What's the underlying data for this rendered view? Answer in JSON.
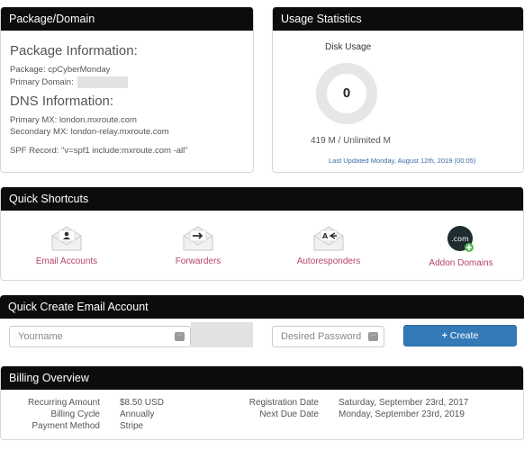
{
  "package_panel": {
    "title": "Package/Domain",
    "package_info_heading": "Package Information:",
    "package_line": "Package: cpCyberMonday",
    "primary_domain_label": "Primary Domain:",
    "dns_heading": "DNS Information:",
    "primary_mx": "Primary MX: london.mxroute.com",
    "secondary_mx": "Secondary MX: london-relay.mxroute.com",
    "spf": "SPF Record: \"v=spf1 include:mxroute.com -all\""
  },
  "usage_panel": {
    "title": "Usage Statistics",
    "disk_label": "Disk Usage",
    "gauge_value": "0",
    "usage_text": "419 M / Unlimited M",
    "updated": "Last Updated Monday, August 12th, 2019 (00:05)"
  },
  "shortcuts_panel": {
    "title": "Quick Shortcuts",
    "items": [
      {
        "label": "Email Accounts",
        "icon": "envelope-user-icon"
      },
      {
        "label": "Forwarders",
        "icon": "envelope-forward-icon"
      },
      {
        "label": "Autoresponders",
        "icon": "envelope-autoreply-icon"
      },
      {
        "label": "Addon Domains",
        "icon": "dotcom-add-icon",
        "icon_text": ".com"
      }
    ]
  },
  "create_panel": {
    "title": "Quick Create Email Account",
    "username_placeholder": "Yourname",
    "password_placeholder": "Desired Password",
    "create_button": "Create"
  },
  "billing_panel": {
    "title": "Billing Overview",
    "left_labels": [
      "Recurring Amount",
      "Billing Cycle",
      "Payment Method"
    ],
    "left_values": [
      "$8.50 USD",
      "Annually",
      "Stripe"
    ],
    "right_labels": [
      "Registration Date",
      "Next Due Date"
    ],
    "right_values": [
      "Saturday, September 23rd, 2017",
      "Monday, September 23rd, 2019"
    ]
  },
  "colors": {
    "header_bg": "#0c0c0c",
    "link_pink": "#b5456a",
    "button_blue": "#337ab7",
    "updated_blue": "#3a6aa5"
  }
}
